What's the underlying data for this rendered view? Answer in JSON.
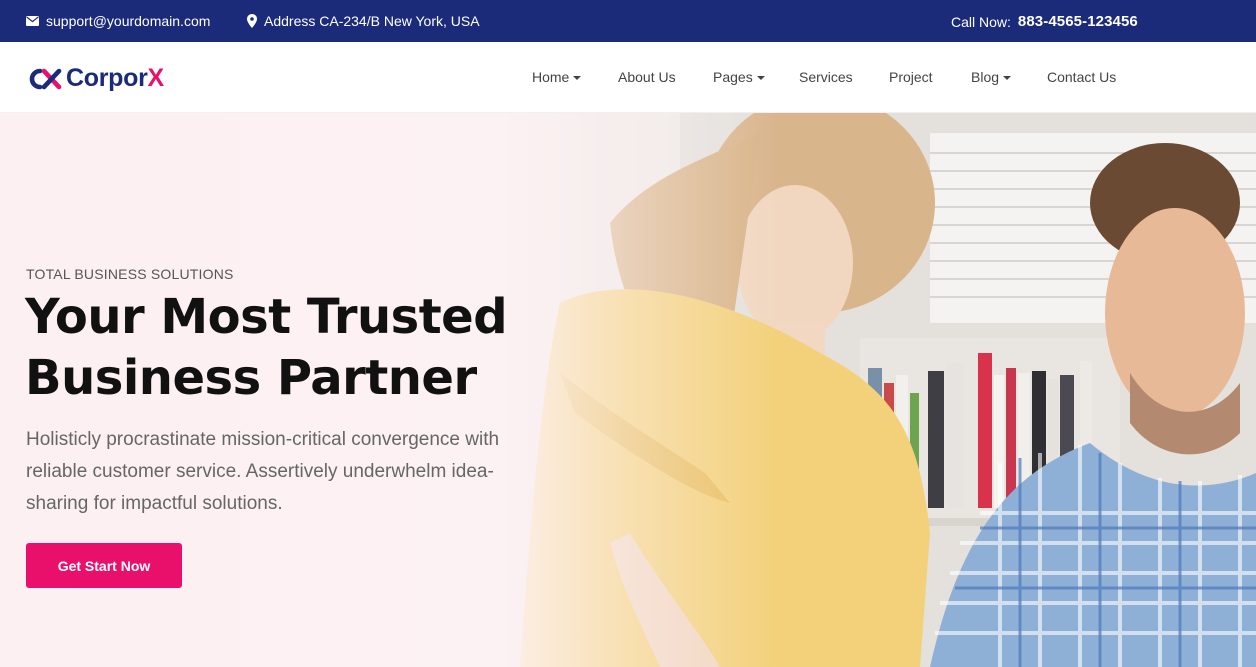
{
  "topbar": {
    "email": "support@yourdomain.com",
    "address": "Address CA-234/B New York, USA",
    "call_label": "Call Now:",
    "phone": "883-4565-123456",
    "background": "#1b2b7a"
  },
  "brand": {
    "name_main": "Corpor",
    "name_accent": "X",
    "primary": "#1b2b7a",
    "accent": "#e8106a"
  },
  "nav": {
    "items": [
      {
        "label": "Home",
        "dropdown": true
      },
      {
        "label": "About Us",
        "dropdown": false
      },
      {
        "label": "Pages",
        "dropdown": true
      },
      {
        "label": "Services",
        "dropdown": false
      },
      {
        "label": "Project",
        "dropdown": false
      },
      {
        "label": "Blog",
        "dropdown": true
      },
      {
        "label": "Contact Us",
        "dropdown": false
      }
    ]
  },
  "hero": {
    "eyebrow": "TOTAL BUSINESS SOLUTIONS",
    "title_line1": "Your Most Trusted",
    "title_line2": "Business Partner",
    "description": "Holisticly procrastinate mission-critical convergence with reliable customer service. Assertively underwhelm idea-sharing for impactful solutions.",
    "cta_label": "Get Start Now"
  },
  "icons": {
    "email": "envelope-icon",
    "address": "map-pin-icon",
    "dropdown": "caret-down-icon"
  }
}
